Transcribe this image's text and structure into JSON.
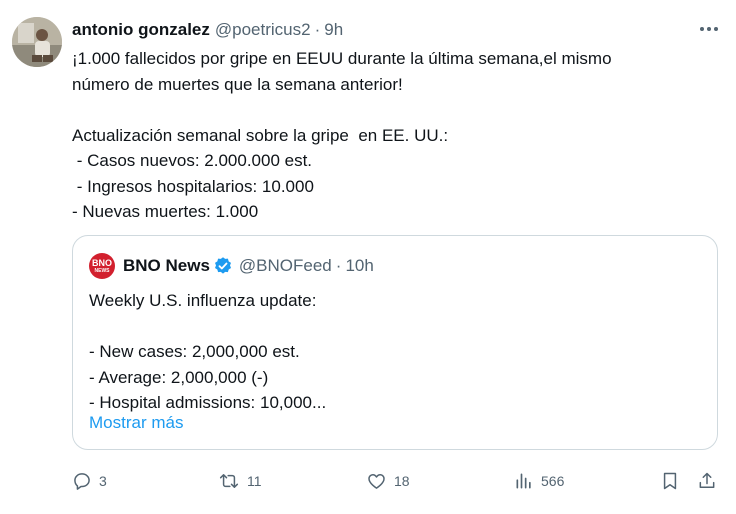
{
  "author": {
    "name": "antonio gonzalez",
    "handle": "@poetricus2",
    "separator": "·",
    "time": "9h"
  },
  "tweet_lines": [
    "¡1.000 fallecidos por gripe en EEUU durante la última semana,el mismo",
    "número de muertes que la semana anterior!",
    "",
    "Actualización semanal sobre la gripe  en EE. UU.:",
    " - Casos nuevos: 2.000.000 est.",
    " - Ingresos hospitalarios: 10.000",
    "- Nuevas muertes: 1.000"
  ],
  "quoted": {
    "logo_line1": "BNO",
    "logo_line2": "NEWS",
    "name": "BNO News",
    "handle": "@BNOFeed",
    "separator": "·",
    "time": "10h",
    "lines": [
      "Weekly U.S. influenza update:",
      "",
      "- New cases: 2,000,000 est.",
      "- Average: 2,000,000 (-)",
      "- Hospital admissions: 10,000..."
    ],
    "show_more": "Mostrar más"
  },
  "actions": {
    "replies": "3",
    "retweets": "11",
    "likes": "18",
    "views": "566"
  },
  "colors": {
    "text": "#0f1419",
    "secondary": "#536471",
    "link": "#1d9bf0",
    "border": "#cfd9de",
    "verified": "#1d9bf0",
    "bno_red": "#d2202e"
  },
  "icons": [
    "more-icon",
    "verified-icon",
    "reply-icon",
    "retweet-icon",
    "like-icon",
    "views-icon",
    "bookmark-icon",
    "share-icon"
  ]
}
